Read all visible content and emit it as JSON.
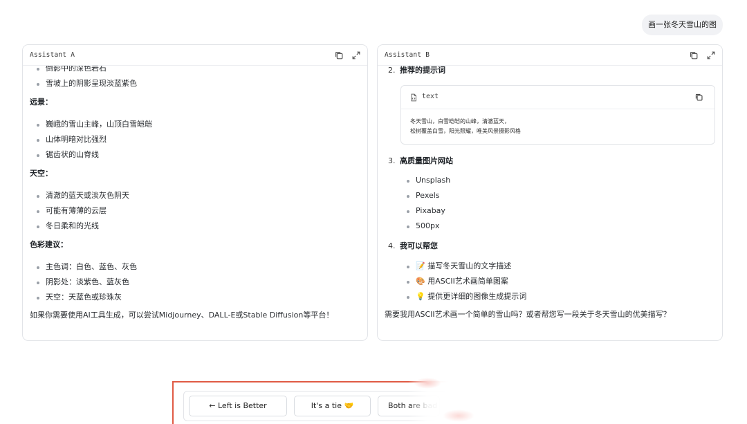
{
  "user_message": "画一张冬天雪山的图",
  "panel_a": {
    "title": "Assistant A",
    "partial_top": "倒影中的深色岩石",
    "list1": [
      "雪坡上的阴影呈现淡蓝紫色"
    ],
    "sec_far": "远景：",
    "list_far": [
      "巍峨的雪山主峰，山顶白雪皑皑",
      "山体明暗对比强烈",
      "锯齿状的山脊线"
    ],
    "sec_sky": "天空：",
    "list_sky": [
      "清澈的蓝天或淡灰色阴天",
      "可能有薄薄的云层",
      "冬日柔和的光线"
    ],
    "sec_color": "色彩建议：",
    "list_color": [
      "主色调：白色、蓝色、灰色",
      "阴影处：淡紫色、蓝灰色",
      "天空：天蓝色或珍珠灰"
    ],
    "footer": "如果你需要使用AI工具生成，可以尝试Midjourney、DALL-E或Stable Diffusion等平台！"
  },
  "panel_b": {
    "title": "Assistant B",
    "h2_num": "2.",
    "h2": "推荐的提示词",
    "code_label": "text",
    "code_line1": "冬天雪山，白雪皑皑的山峰，清澈蓝天，",
    "code_line2": "松树覆盖白雪，阳光照耀，唯美风景摄影风格",
    "h3_num": "3.",
    "h3": "高质量图片网站",
    "sites": [
      "Unsplash",
      "Pexels",
      "Pixabay",
      "500px"
    ],
    "h4_num": "4.",
    "h4": "我可以帮您",
    "help": [
      "📝 描写冬天雪山的文字描述",
      "🎨 用ASCII艺术画简单图案",
      "💡 提供更详细的图像生成提示词"
    ],
    "footer": "需要我用ASCII艺术画一个简单的雪山吗？或者帮您写一段关于冬天雪山的优美描写？"
  },
  "vote": {
    "left": "← Left is Better",
    "tie": "It's a tie 🤝",
    "both": "Both are bad"
  },
  "icons": {
    "copy": "copy-icon",
    "expand": "expand-icon",
    "file": "file-code-icon"
  }
}
